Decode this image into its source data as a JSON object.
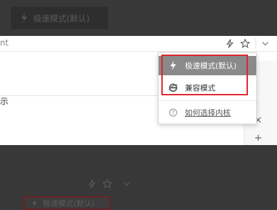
{
  "top_overlay": {
    "button_label": "极速模式(默认)"
  },
  "address_bar": {
    "url_fragment": "nt"
  },
  "content": {
    "left_fragment": "示"
  },
  "menu": {
    "items": [
      {
        "label": "极速模式(默认)",
        "icon": "lightning-icon",
        "selected": true
      },
      {
        "label": "兼容模式",
        "icon": "ie-icon",
        "selected": false
      }
    ],
    "help": {
      "label": "如何选择内核",
      "icon": "question-icon"
    }
  },
  "bottom_overlay": {
    "button_label": "极速模式(默认)"
  },
  "colors": {
    "highlight_red": "#e0232a",
    "selected_bg": "#8a8a8a"
  }
}
